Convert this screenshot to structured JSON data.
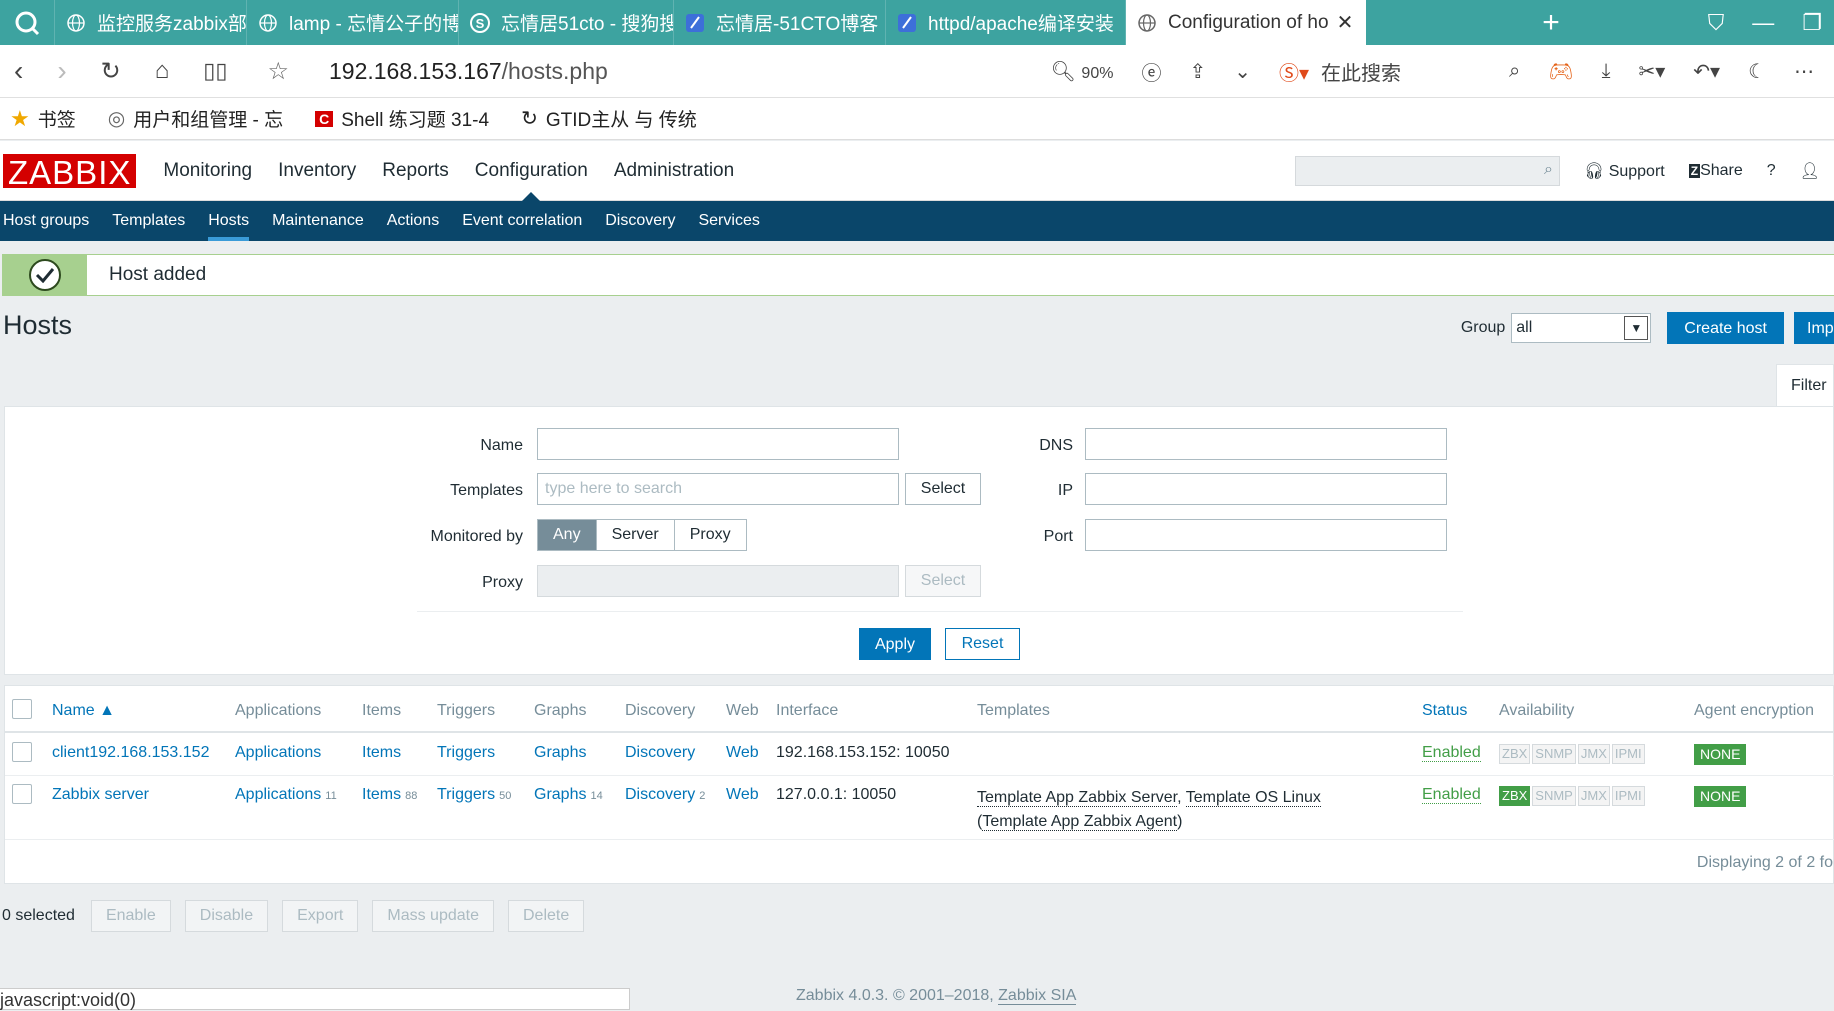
{
  "browser": {
    "tabs": [
      {
        "label": "监控服务zabbix部署 -",
        "icon": "globe-icon",
        "active": false
      },
      {
        "label": "lamp - 忘情公子的博客",
        "icon": "globe-icon",
        "active": false
      },
      {
        "label": "忘情居51cto - 搜狗搜",
        "icon": "sogou-icon",
        "active": false
      },
      {
        "label": "忘情居-51CTO博客",
        "icon": "feather-icon",
        "active": false
      },
      {
        "label": "httpd/apache编译安装",
        "icon": "feather-icon",
        "active": false
      },
      {
        "label": "Configuration of ho",
        "icon": "globe-icon",
        "active": true
      }
    ],
    "url_host": "192.168.153.167",
    "url_path": "/hosts.php",
    "zoom": "90%",
    "search_label": "在此搜索",
    "bookmarks": [
      "书签",
      "用户和组管理 - 忘",
      "Shell 练习题 31-4",
      "GTID主从 与 传统"
    ],
    "status_url": "javascript:void(0)"
  },
  "header": {
    "logo": "ZABBIX",
    "menu": [
      "Monitoring",
      "Inventory",
      "Reports",
      "Configuration",
      "Administration"
    ],
    "support": "Support",
    "share": "Share",
    "help": "?",
    "submenu": [
      "Host groups",
      "Templates",
      "Hosts",
      "Maintenance",
      "Actions",
      "Event correlation",
      "Discovery",
      "Services"
    ]
  },
  "message": "Host added",
  "page": {
    "title": "Hosts",
    "group_label": "Group",
    "group_value": "all",
    "create_button": "Create host",
    "import_button": "Imp",
    "filter_tab": "Filter"
  },
  "filter": {
    "name_label": "Name",
    "templates_label": "Templates",
    "templates_placeholder": "type here to search",
    "select_label": "Select",
    "monitored_label": "Monitored by",
    "monitored_options": [
      "Any",
      "Server",
      "Proxy"
    ],
    "proxy_label": "Proxy",
    "dns_label": "DNS",
    "ip_label": "IP",
    "port_label": "Port",
    "apply": "Apply",
    "reset": "Reset"
  },
  "table": {
    "columns": [
      "Name ▲",
      "Applications",
      "Items",
      "Triggers",
      "Graphs",
      "Discovery",
      "Web",
      "Interface",
      "Templates",
      "Status",
      "Availability",
      "Agent encryption"
    ],
    "rows": [
      {
        "name": "client192.168.153.152",
        "applications": "Applications",
        "applications_count": "",
        "items": "Items",
        "items_count": "",
        "triggers": "Triggers",
        "triggers_count": "",
        "graphs": "Graphs",
        "graphs_count": "",
        "discovery": "Discovery",
        "discovery_count": "",
        "web": "Web",
        "interface": "192.168.153.152: 10050",
        "templates_line1": "",
        "templates_line2": "",
        "status": "Enabled",
        "availability": [
          "ZBX",
          "SNMP",
          "JMX",
          "IPMI"
        ],
        "zbx_on": false,
        "encryption": "NONE"
      },
      {
        "name": "Zabbix server",
        "applications": "Applications",
        "applications_count": "11",
        "items": "Items",
        "items_count": "88",
        "triggers": "Triggers",
        "triggers_count": "50",
        "graphs": "Graphs",
        "graphs_count": "14",
        "discovery": "Discovery",
        "discovery_count": "2",
        "web": "Web",
        "interface": "127.0.0.1: 10050",
        "template_a": "Template App Zabbix Server",
        "template_b": "Template OS Linux",
        "template_c": "Template App Zabbix Agent",
        "status": "Enabled",
        "availability": [
          "ZBX",
          "SNMP",
          "JMX",
          "IPMI"
        ],
        "zbx_on": true,
        "encryption": "NONE"
      }
    ],
    "displaying": "Displaying 2 of 2 fo"
  },
  "mass": {
    "selected": "0 selected",
    "buttons": [
      "Enable",
      "Disable",
      "Export",
      "Mass update",
      "Delete"
    ]
  },
  "footer": {
    "text": "Zabbix 4.0.3. © 2001–2018, ",
    "link": "Zabbix SIA"
  },
  "colors": {
    "brand": "#d40000",
    "nav": "#0a466a",
    "accent": "#0275b8",
    "ok": "#429e47",
    "tabbar": "#3da3a0"
  }
}
